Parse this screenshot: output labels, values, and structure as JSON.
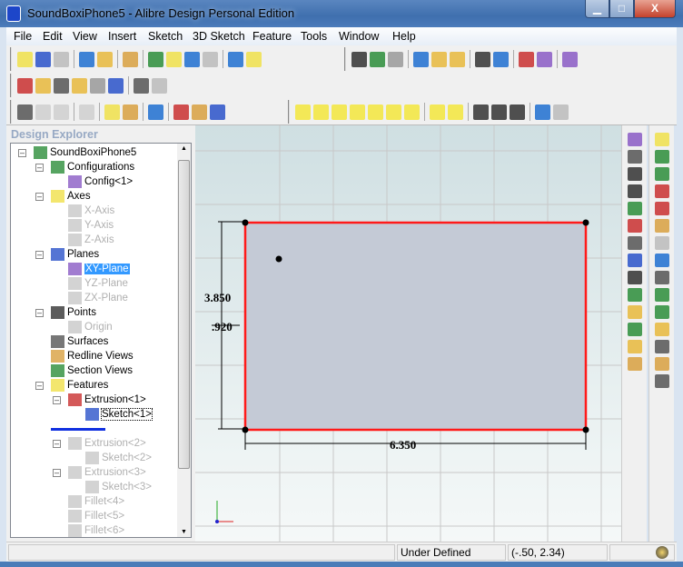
{
  "window": {
    "title": "SoundBoxiPhone5 - Alibre Design Personal Edition",
    "minimize": "▁",
    "maximize": "□",
    "close": "X"
  },
  "menu": [
    "File",
    "Edit",
    "View",
    "Insert",
    "Sketch",
    "3D Sketch",
    "Feature",
    "Tools",
    "Window",
    "Help"
  ],
  "toolbars": {
    "row1a": [
      "new-part-icon",
      "open-folder-icon",
      "save-icon",
      "sep",
      "open-recent-icon",
      "settings-icon",
      "sep",
      "print-icon",
      "sep",
      "cut-icon",
      "copy-icon",
      "paste-icon",
      "delete-icon",
      "sep",
      "undo-icon",
      "redo-icon"
    ],
    "row1b": [
      "select-arrow-icon",
      "zoom-fit-icon",
      "rotate-icon",
      "sep",
      "zoom-in-icon",
      "zoom-window-icon",
      "zoom-icon",
      "sep",
      "previous-view-icon",
      "next-view-icon",
      "sep",
      "sketch-mode-icon",
      "plane-icon",
      "sep",
      "render-icon"
    ],
    "row2": [
      "plane-insert-icon",
      "axis-insert-icon",
      "point-insert-icon",
      "surface-icon",
      "list-icon",
      "section-view-icon",
      "sep",
      "measure-icon",
      "balance-icon"
    ],
    "row3a": [
      "constraint-icon",
      "constraint-disabled-icon",
      "constraint-disabled-icon",
      "sep",
      "paste-disabled-icon",
      "sep",
      "dimension-icon",
      "reference-dimension-icon",
      "sep",
      "toggle-icon",
      "sep",
      "grid-snap-icon",
      "grid-select-icon",
      "grid-icon"
    ],
    "row3b": [
      "view-iso-icon",
      "view-front-icon",
      "view-back-icon",
      "view-right-icon",
      "view-left-icon",
      "view-top-icon",
      "view-bottom-icon",
      "sep",
      "view-rotate-left-icon",
      "view-rotate-right-icon",
      "sep",
      "display-icon",
      "section-icon",
      "shading-icon",
      "sep",
      "edit-icon",
      "target-icon"
    ]
  },
  "explorer": {
    "title": "Design Explorer",
    "nodes": [
      {
        "label": "SoundBoxiPhone5",
        "level": 0,
        "toggle": true,
        "icon": "part-icon",
        "state": "normal"
      },
      {
        "label": "Configurations",
        "level": 1,
        "toggle": true,
        "icon": "configurations-icon",
        "state": "normal"
      },
      {
        "label": "Config<1>",
        "level": 2,
        "toggle": false,
        "icon": "configuration-icon",
        "state": "normal"
      },
      {
        "label": "Axes",
        "level": 1,
        "toggle": true,
        "icon": "axes-icon",
        "state": "normal"
      },
      {
        "label": "X-Axis",
        "level": 2,
        "toggle": false,
        "icon": "axis-icon",
        "state": "dim"
      },
      {
        "label": "Y-Axis",
        "level": 2,
        "toggle": false,
        "icon": "axis-icon",
        "state": "dim"
      },
      {
        "label": "Z-Axis",
        "level": 2,
        "toggle": false,
        "icon": "axis-icon",
        "state": "dim"
      },
      {
        "label": "Planes",
        "level": 1,
        "toggle": true,
        "icon": "planes-icon",
        "state": "normal"
      },
      {
        "label": "XY-Plane",
        "level": 2,
        "toggle": false,
        "icon": "plane-icon",
        "state": "selected"
      },
      {
        "label": "YZ-Plane",
        "level": 2,
        "toggle": false,
        "icon": "plane-icon",
        "state": "dim"
      },
      {
        "label": "ZX-Plane",
        "level": 2,
        "toggle": false,
        "icon": "plane-icon",
        "state": "dim"
      },
      {
        "label": "Points",
        "level": 1,
        "toggle": true,
        "icon": "points-icon",
        "state": "normal"
      },
      {
        "label": "Origin",
        "level": 2,
        "toggle": false,
        "icon": "origin-icon",
        "state": "dim"
      },
      {
        "label": "Surfaces",
        "level": 1,
        "toggle": false,
        "icon": "surfaces-icon",
        "state": "normal"
      },
      {
        "label": "Redline Views",
        "level": 1,
        "toggle": false,
        "icon": "redline-icon",
        "state": "normal"
      },
      {
        "label": "Section Views",
        "level": 1,
        "toggle": false,
        "icon": "section-views-icon",
        "state": "normal"
      },
      {
        "label": "Features",
        "level": 1,
        "toggle": true,
        "icon": "features-icon",
        "state": "normal"
      },
      {
        "label": "Extrusion<1>",
        "level": 2,
        "toggle": true,
        "icon": "extrusion-icon",
        "state": "normal"
      },
      {
        "label": "Sketch<1>",
        "level": 3,
        "toggle": false,
        "icon": "sketch-icon",
        "state": "focused"
      },
      {
        "label": "",
        "level": 2,
        "toggle": false,
        "icon": "rollback-bar-icon",
        "state": "rollback"
      },
      {
        "label": "Extrusion<2>",
        "level": 2,
        "toggle": true,
        "icon": "extrusion-icon",
        "state": "dim"
      },
      {
        "label": "Sketch<2>",
        "level": 3,
        "toggle": false,
        "icon": "sketch-icon",
        "state": "dim"
      },
      {
        "label": "Extrusion<3>",
        "level": 2,
        "toggle": true,
        "icon": "extrusion-icon",
        "state": "dim"
      },
      {
        "label": "Sketch<3>",
        "level": 3,
        "toggle": false,
        "icon": "sketch-icon",
        "state": "dim"
      },
      {
        "label": "Fillet<4>",
        "level": 2,
        "toggle": false,
        "icon": "fillet-icon",
        "state": "dim"
      },
      {
        "label": "Fillet<5>",
        "level": 2,
        "toggle": false,
        "icon": "fillet-icon",
        "state": "dim"
      },
      {
        "label": "Fillet<6>",
        "level": 2,
        "toggle": false,
        "icon": "fillet-icon",
        "state": "dim"
      }
    ]
  },
  "sketch": {
    "dim_height": "3.850",
    "dim_offset": ".920",
    "dim_width": "6.350",
    "line_color": "#ff1a1a",
    "fill_color": "#c4cad6"
  },
  "right_toolbar_1": [
    "sketch-activate-icon",
    "point-icon",
    "construction-line-icon",
    "line-icon",
    "line-segment-icon",
    "circle-icon",
    "arc-icon",
    "rectangle-icon",
    "spline-icon",
    "sketch-point-icon",
    "text-icon",
    "trim-icon",
    "fillet-sketch-icon",
    "pattern-icon"
  ],
  "right_toolbar_2": [
    "extrude-icon",
    "cut-icon",
    "revolve-icon",
    "loft-icon",
    "sweep-icon",
    "hole-icon",
    "shell-icon",
    "helix-icon",
    "thread-icon",
    "sphere-icon",
    "draft-icon",
    "box-icon",
    "cylinder-icon",
    "pattern-3d-icon",
    "mirror-icon"
  ],
  "status": {
    "left": "",
    "state": "Under Defined",
    "coords": "(-.50, 2.34)"
  }
}
